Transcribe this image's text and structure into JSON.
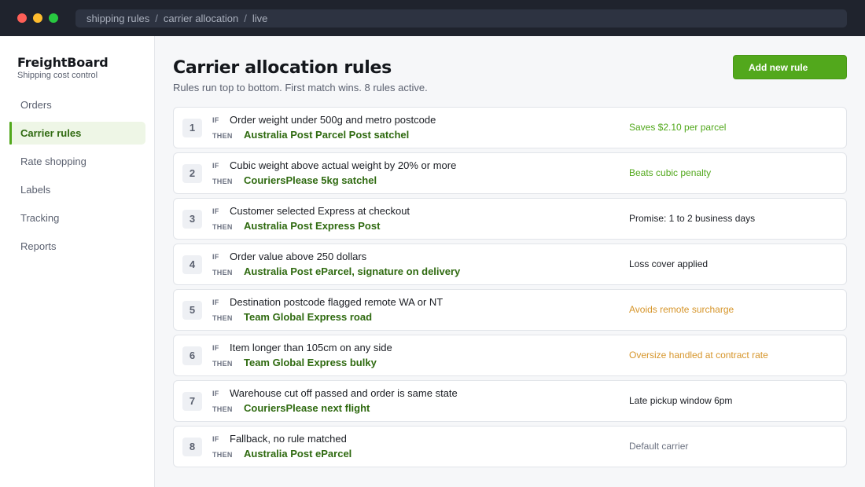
{
  "window": {
    "breadcrumb": [
      "shipping rules",
      "carrier allocation",
      "live"
    ],
    "breadcrumb_separator": "/"
  },
  "sidebar": {
    "brand": "FreightBoard",
    "brand_sub": "Shipping cost control",
    "items": [
      {
        "label": "Orders",
        "active": false
      },
      {
        "label": "Carrier rules",
        "active": true
      },
      {
        "label": "Rate shopping",
        "active": false
      },
      {
        "label": "Labels",
        "active": false
      },
      {
        "label": "Tracking",
        "active": false
      },
      {
        "label": "Reports",
        "active": false
      }
    ]
  },
  "main": {
    "title": "Carrier allocation rules",
    "subtitle": "Rules run top to bottom. First match wins. 8 rules active.",
    "add_button": "Add new rule",
    "if_label": "IF",
    "then_label": "THEN",
    "rules": [
      {
        "num": "1",
        "condition": "Order weight under 500g and metro postcode",
        "carrier": "Australia Post Parcel Post satchel",
        "note": "Saves $2.10 per parcel",
        "tone": "saving"
      },
      {
        "num": "2",
        "condition": "Cubic weight above actual weight by 20% or more",
        "carrier": "CouriersPlease 5kg satchel",
        "note": "Beats cubic penalty",
        "tone": "saving"
      },
      {
        "num": "3",
        "condition": "Customer selected Express at checkout",
        "carrier": "Australia Post Express Post",
        "note": "Promise: 1 to 2 business days",
        "tone": "info"
      },
      {
        "num": "4",
        "condition": "Order value above 250 dollars",
        "carrier": "Australia Post eParcel, signature on delivery",
        "note": "Loss cover applied",
        "tone": "info"
      },
      {
        "num": "5",
        "condition": "Destination postcode flagged remote WA or NT",
        "carrier": "Team Global Express road",
        "note": "Avoids remote surcharge",
        "tone": "warn"
      },
      {
        "num": "6",
        "condition": "Item longer than 105cm on any side",
        "carrier": "Team Global Express bulky",
        "note": "Oversize handled at contract rate",
        "tone": "warn"
      },
      {
        "num": "7",
        "condition": "Warehouse cut off passed and order is same state",
        "carrier": "CouriersPlease next flight",
        "note": "Late pickup window 6pm",
        "tone": "info"
      },
      {
        "num": "8",
        "condition": "Fallback, no rule matched",
        "carrier": "Australia Post eParcel",
        "note": "Default carrier",
        "tone": "muted"
      }
    ]
  },
  "colors": {
    "accent": "#52a81c",
    "accent_dark": "#2f6a10",
    "warning": "#d6952a",
    "titlebar": "#1f232d"
  }
}
